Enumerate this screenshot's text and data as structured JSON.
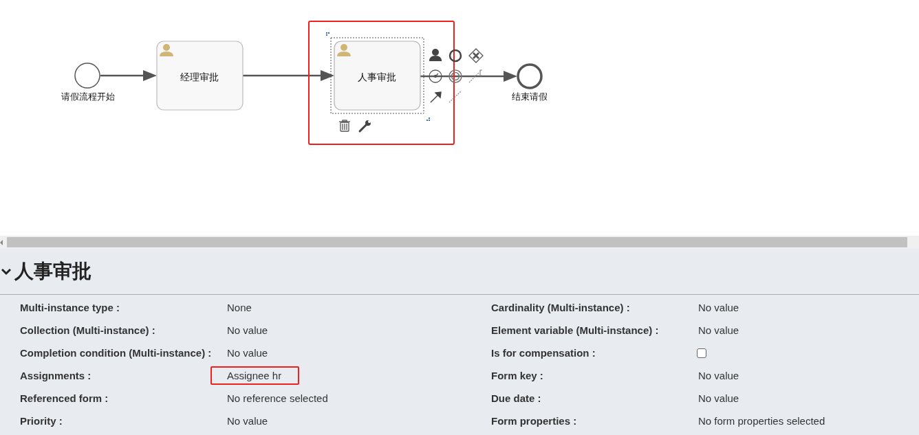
{
  "diagram": {
    "start_event": {
      "label": "请假流程开始"
    },
    "tasks": [
      {
        "label": "经理审批",
        "selected": false,
        "highlighted": false
      },
      {
        "label": "人事审批",
        "selected": true,
        "highlighted": true
      }
    ],
    "end_event": {
      "label": "结束请假"
    }
  },
  "properties": {
    "title": "人事审批",
    "expanded": true,
    "columns": [
      [
        {
          "kind": "text",
          "label": "Multi-instance type :",
          "value": "None",
          "highlighted": false
        },
        {
          "kind": "text",
          "label": "Collection (Multi-instance) :",
          "value": "No value",
          "highlighted": false
        },
        {
          "kind": "text",
          "label": "Completion condition (Multi-instance) :",
          "value": "No value",
          "highlighted": false
        },
        {
          "kind": "text",
          "label": "Assignments :",
          "value": "Assignee hr",
          "highlighted": true
        },
        {
          "kind": "text",
          "label": "Referenced form :",
          "value": "No reference selected",
          "highlighted": false
        },
        {
          "kind": "text",
          "label": "Priority :",
          "value": "No value",
          "highlighted": false
        }
      ],
      [
        {
          "kind": "text",
          "label": "Cardinality (Multi-instance) :",
          "value": "No value",
          "highlighted": false
        },
        {
          "kind": "text",
          "label": "Element variable (Multi-instance) :",
          "value": "No value",
          "highlighted": false
        },
        {
          "kind": "checkbox",
          "label": "Is for compensation :",
          "checked": false
        },
        {
          "kind": "text",
          "label": "Form key :",
          "value": "No value",
          "highlighted": false
        },
        {
          "kind": "text",
          "label": "Due date :",
          "value": "No value",
          "highlighted": false
        },
        {
          "kind": "text",
          "label": "Form properties :",
          "value": "No form properties selected",
          "highlighted": false
        }
      ]
    ]
  }
}
